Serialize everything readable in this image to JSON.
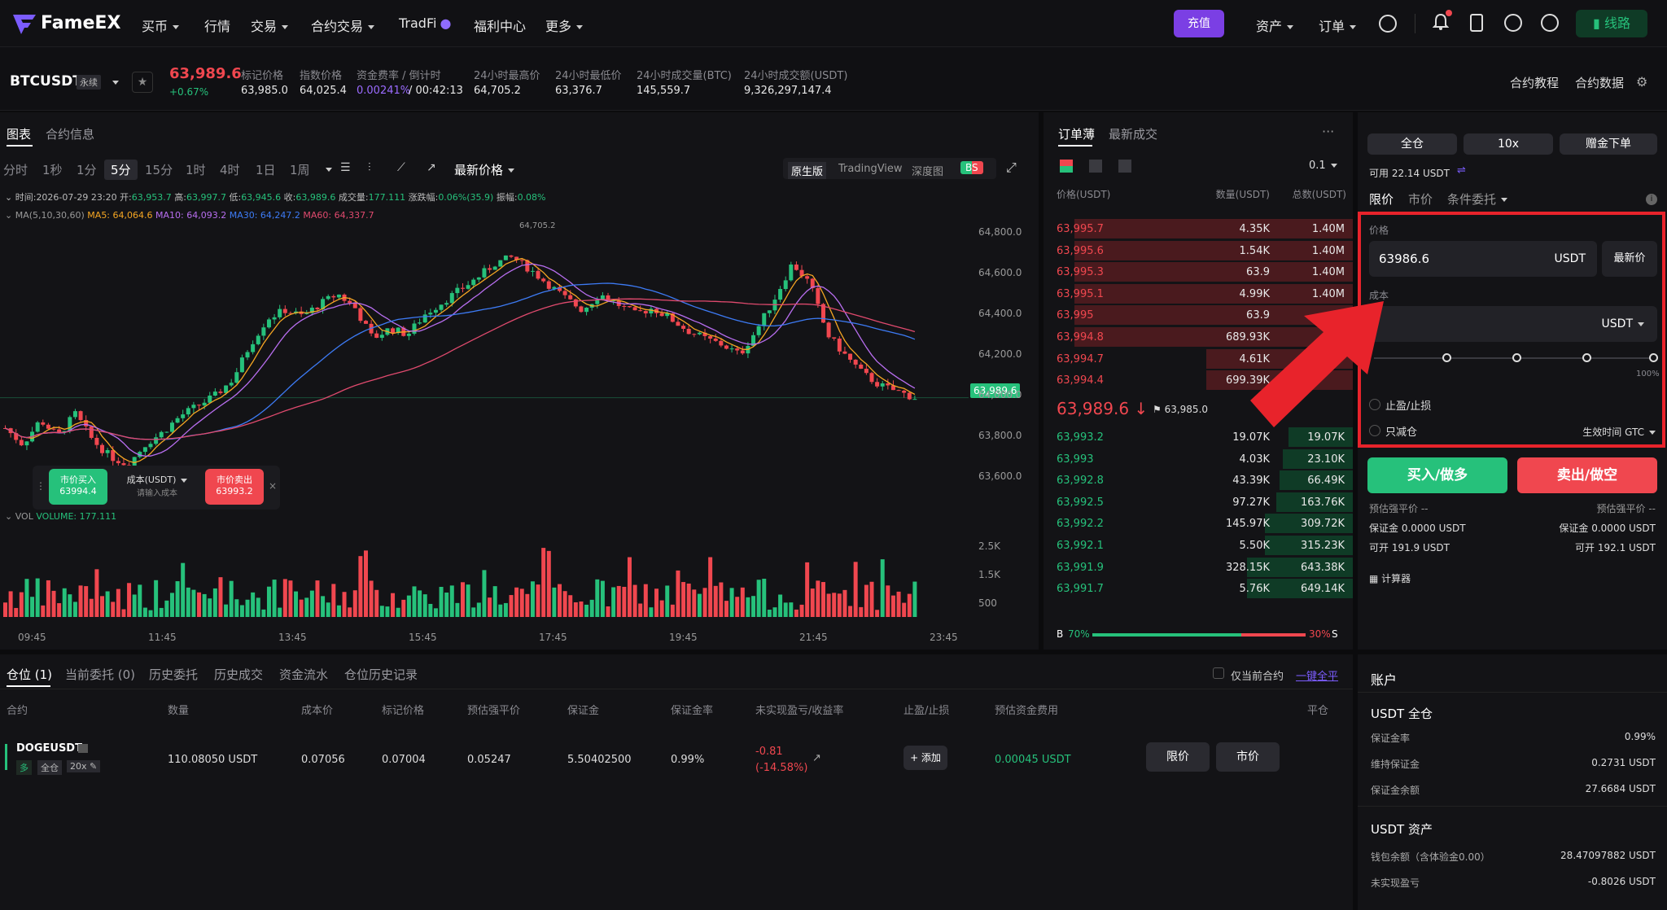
{
  "nav": {
    "brand": "FameEX",
    "items": [
      "买币",
      "行情",
      "交易",
      "合约交易",
      "TradFi",
      "福利中心",
      "更多"
    ],
    "deposit": "充值",
    "assets": "资产",
    "orders": "订单",
    "route": "线路"
  },
  "ticker": {
    "symbol": "BTCUSDT",
    "type": "永续",
    "price": "63,989.6",
    "change": "+0.67%",
    "stats": [
      {
        "label": "标记价格",
        "value": "63,985.0"
      },
      {
        "label": "指数价格",
        "value": "64,025.4"
      },
      {
        "label": "资金费率 / 倒计时",
        "value": "0.00241%",
        "value2": "/ 00:42:13"
      },
      {
        "label": "24小时最高价",
        "value": "64,705.2"
      },
      {
        "label": "24小时最低价",
        "value": "63,376.7"
      },
      {
        "label": "24小时成交量(BTC)",
        "value": "145,559.7"
      },
      {
        "label": "24小时成交额(USDT)",
        "value": "9,326,297,147.4"
      }
    ],
    "tutorial": "合约教程",
    "data": "合约数据"
  },
  "chart_panel": {
    "tabs": [
      "图表",
      "合约信息"
    ],
    "intervals": [
      "分时",
      "1秒",
      "1分",
      "5分",
      "15分",
      "1时",
      "4时",
      "1日",
      "1周"
    ],
    "active_interval": "5分",
    "price_mode": "最新价格",
    "views": [
      "原生版",
      "TradingView",
      "深度图"
    ],
    "bs_badge": "BS",
    "info_line": {
      "time_label": "时间:",
      "time": "2026-07-29 23:20",
      "open_label": "开:",
      "open": "63,953.7",
      "high_label": "高:",
      "high": "63,997.7",
      "low_label": "低:",
      "low": "63,945.6",
      "close_label": "收:",
      "close": "63,989.6",
      "vol_label": "成交量:",
      "vol": "177.111",
      "chg_label": "涨跌幅:",
      "chg": "0.06%(35.9)",
      "amp_label": "振幅:",
      "amp": "0.08%"
    },
    "ma_line": {
      "label": "MA(5,10,30,60)",
      "ma5": "MA5: 64,064.6",
      "ma10": "MA10: 64,093.2",
      "ma30": "MA30: 64,247.2",
      "ma60": "MA60: 64,337.7"
    },
    "high_marker": "64,705.2",
    "current_price_tag": "63,989.6",
    "vol_label": "VOL",
    "vol_value": "VOLUME: 177.111",
    "quick_trade": {
      "buy_label": "市价买入",
      "buy_price": "63994.4",
      "cost_label": "成本(USDT)",
      "cost_placeholder": "请输入成本",
      "sell_label": "市价卖出",
      "sell_price": "63993.2"
    }
  },
  "chart_data": {
    "type": "candlestick",
    "price_axis": [
      "64,800.0",
      "64,600.0",
      "64,400.0",
      "64,200.0",
      "64,000.0",
      "63,800.0",
      "63,600.0"
    ],
    "ylim": [
      63600,
      64800
    ],
    "volume_axis": [
      "2.5K",
      "1.5K",
      "500"
    ],
    "time_axis": [
      "09:45",
      "11:45",
      "13:45",
      "15:45",
      "17:45",
      "19:45",
      "21:45",
      "23:45"
    ],
    "close_path": [
      63840,
      63760,
      63880,
      63800,
      63910,
      63780,
      63700,
      63660,
      63760,
      63820,
      63900,
      63950,
      64000,
      64080,
      64250,
      64380,
      64420,
      64390,
      64450,
      64500,
      64430,
      64280,
      64330,
      64300,
      64400,
      64460,
      64520,
      64580,
      64650,
      64680,
      64620,
      64550,
      64480,
      64420,
      64500,
      64450,
      64400,
      64430,
      64380,
      64320,
      64280,
      64250,
      64200,
      64330,
      64480,
      64650,
      64550,
      64300,
      64200,
      64110,
      64050,
      64020,
      63989.6
    ],
    "ma_series": [
      "MA5",
      "MA10",
      "MA30",
      "MA60"
    ]
  },
  "orderbook": {
    "tabs": [
      "订单薄",
      "最新成交"
    ],
    "precision": "0.1",
    "headers": [
      "价格(USDT)",
      "数量(USDT)",
      "总数(USDT)"
    ],
    "asks": [
      [
        "63,995.7",
        "4.35K",
        "1.40M",
        0.95
      ],
      [
        "63,995.6",
        "1.54K",
        "1.40M",
        0.95
      ],
      [
        "63,995.3",
        "63.9",
        "1.40M",
        0.95
      ],
      [
        "63,995.1",
        "4.99K",
        "1.40M",
        0.95
      ],
      [
        "63,995",
        "63.9",
        "",
        0.95
      ],
      [
        "63,994.8",
        "689.93K",
        "1.",
        0.95
      ],
      [
        "63,994.7",
        "4.61K",
        "",
        0.5
      ],
      [
        "63,994.4",
        "699.39K",
        "",
        0.5
      ]
    ],
    "last_price": "63,989.6",
    "mark_price": "63,985.0",
    "bids": [
      [
        "63,993.2",
        "19.07K",
        "19.07K",
        0.22
      ],
      [
        "63,993",
        "4.03K",
        "23.10K",
        0.24
      ],
      [
        "63,992.8",
        "43.39K",
        "66.49K",
        0.25
      ],
      [
        "63,992.5",
        "97.27K",
        "163.76K",
        0.26
      ],
      [
        "63,992.2",
        "145.97K",
        "309.72K",
        0.3
      ],
      [
        "63,992.1",
        "5.50K",
        "315.23K",
        0.3
      ],
      [
        "63,991.9",
        "328.15K",
        "643.38K",
        0.36
      ],
      [
        "63,991.7",
        "5.76K",
        "649.14K",
        0.36
      ]
    ],
    "buy_ratio_label": "B",
    "buy_ratio": "70%",
    "sell_ratio": "30%",
    "sell_ratio_label": "S"
  },
  "order_form": {
    "margin_mode": "全仓",
    "leverage": "10x",
    "gift_order": "赠金下单",
    "available": "可用 22.14 USDT",
    "types": [
      "限价",
      "市价",
      "条件委托"
    ],
    "price_label": "价格",
    "price_value": "63986.6",
    "price_unit": "USDT",
    "latest_btn": "最新价",
    "cost_label": "成本",
    "cost_unit": "USDT",
    "slider_max": "100%",
    "tp_sl": "止盈/止损",
    "reduce_only": "只减仓",
    "tif": "生效时间  GTC",
    "buy_btn": "买入/做多",
    "sell_btn": "卖出/做空",
    "est_liq_l": "预估强平价 --",
    "est_liq_r": "预估强平价 --",
    "margin_l": "保证金 0.0000 USDT",
    "margin_r": "保证金 0.0000 USDT",
    "open_l": "可开 191.9 USDT",
    "open_r": "可开 192.1 USDT",
    "calculator": "计算器"
  },
  "positions": {
    "tabs": [
      "仓位 (1)",
      "当前委托 (0)",
      "历史委托",
      "历史成交",
      "资金流水",
      "仓位历史记录"
    ],
    "only_current": "仅当前合约",
    "close_all": "一键全平",
    "headers": [
      "合约",
      "数量",
      "成本价",
      "标记价格",
      "预估强平价",
      "保证金",
      "保证金率",
      "未实现盈亏/收益率",
      "止盈/止损",
      "预估资金费用",
      "平仓"
    ],
    "row": {
      "symbol": "DOGEUSDT",
      "side": "多",
      "mode": "全仓",
      "lev": "20x",
      "qty": "110.08050 USDT",
      "cost": "0.07056",
      "mark": "0.07004",
      "liq": "0.05247",
      "margin": "5.50402500",
      "margin_rate": "0.99%",
      "pnl": "-0.81",
      "pnl_pct": "(-14.58%)",
      "add": "+ 添加",
      "funding": "0.00045 USDT",
      "limit_btn": "限价",
      "market_btn": "市价"
    }
  },
  "account": {
    "title": "账户",
    "section1": "USDT 全仓",
    "rows1": [
      {
        "label": "保证金率",
        "value": "0.99%"
      },
      {
        "label": "维持保证金",
        "value": "0.2731 USDT"
      },
      {
        "label": "保证金余额",
        "value": "27.6684 USDT"
      }
    ],
    "section2": "USDT 资产",
    "rows2": [
      {
        "label": "钱包余额（含体验金0.00）",
        "value": "28.47097882 USDT"
      },
      {
        "label": "未实现盈亏",
        "value": "-0.8026 USDT"
      }
    ]
  },
  "colors": {
    "up": "#26c17b",
    "down": "#f0474f",
    "accent": "#7b3fe4",
    "highlight": "#e8232b"
  }
}
